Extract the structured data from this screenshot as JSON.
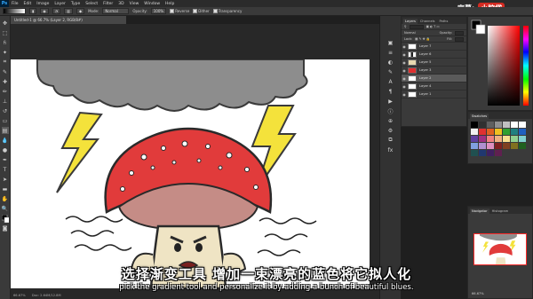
{
  "menu": {
    "logo": "Ps",
    "items": [
      "File",
      "Edit",
      "Image",
      "Layer",
      "Type",
      "Select",
      "Filter",
      "3D",
      "View",
      "Window",
      "Help"
    ]
  },
  "options": {
    "mode_label": "Mode:",
    "mode_value": "Normal",
    "opacity_label": "Opacity:",
    "opacity_value": "100%",
    "reverse_label": "Reverse",
    "dither_label": "Dither",
    "transparency_label": "Transparency"
  },
  "document": {
    "tab_title": "Untitled-1 @ 66.7% (Layer 2, RGB/8#)"
  },
  "watermark": {
    "label": "字幕:",
    "logo": "小脑袋"
  },
  "layers_panel": {
    "tabs": [
      "Layers",
      "Channels",
      "Paths"
    ],
    "blend_mode": "Normal",
    "opacity_label": "Opacity:",
    "lock_label": "Lock:",
    "fill_label": "Fill:",
    "rows": [
      {
        "name": "Layer 7",
        "selected": false
      },
      {
        "name": "Layer 6",
        "selected": false
      },
      {
        "name": "Layer 5",
        "selected": false
      },
      {
        "name": "Layer 3",
        "selected": false
      },
      {
        "name": "Layer 2",
        "selected": true
      },
      {
        "name": "Layer 4",
        "selected": false
      },
      {
        "name": "Layer 1",
        "selected": false
      }
    ]
  },
  "swatches_panel": {
    "tab": "Swatches",
    "colors": [
      "#000000",
      "#303030",
      "#606060",
      "#909090",
      "#c0c0c0",
      "#ffffff",
      "#ffffff",
      "#f0f0f0",
      "#e03030",
      "#e06020",
      "#f0c020",
      "#30a030",
      "#208080",
      "#2060c0",
      "#6040a0",
      "#a03080",
      "#f08080",
      "#f0b080",
      "#f8e090",
      "#90d090",
      "#80d0d0",
      "#80a0e0",
      "#b090d0",
      "#e090c0",
      "#802020",
      "#804020",
      "#807020",
      "#206020",
      "#205050",
      "#203870",
      "#402060",
      "#602050"
    ]
  },
  "navigator_panel": {
    "tabs": [
      "Navigator",
      "Histogram"
    ],
    "zoom": "66.67%"
  },
  "status": {
    "zoom": "66.67%",
    "doc": "Doc: 2.64M/12.8M"
  },
  "subtitles": {
    "chinese": "选择渐变工具 增加一束漂亮的蓝色将它拟人化",
    "english": "pick the gradient tool and personalize it by adding a bunch of beautiful blues."
  }
}
